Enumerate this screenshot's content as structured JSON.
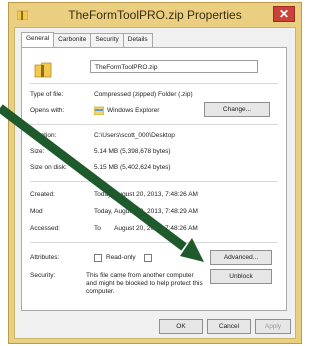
{
  "window": {
    "title": "TheFormToolPRO.zip Properties",
    "close_glyph": "✕"
  },
  "tabs": [
    {
      "label": "General",
      "active": true
    },
    {
      "label": "Carbonite"
    },
    {
      "label": "Security"
    },
    {
      "label": "Details"
    }
  ],
  "general": {
    "file_name": "TheFormToolPRO.zip",
    "type_label": "Type of file:",
    "type_value": "Compressed (zipped) Folder (.zip)",
    "opens_label": "Opens with:",
    "opens_value": "Windows Explorer",
    "change_label": "Change...",
    "location_label": "Location:",
    "location_value": "C:\\Users\\scott_000\\Desktop",
    "size_label": "Size:",
    "size_value": "5.14 MB (5,398,678 bytes)",
    "size_on_disk_label": "Size on disk:",
    "size_on_disk_value": "5.15 MB (5,402,624 bytes)",
    "created_label": "Created:",
    "created_value": "Today, August 20, 2013, 7:48:26 AM",
    "modified_label": "Mod",
    "modified_value": "Today, August 20, 2013, 7:48:29 AM",
    "accessed_label": "Accessed:",
    "accessed_value": "August 20, 2013, 7:48:26 AM",
    "accessed_prefix": "To",
    "attributes_label": "Attributes:",
    "readonly_label": "Read-only",
    "hidden_label": "",
    "advanced_label": "Advanced...",
    "security_label": "Security:",
    "security_text": "This file came from another computer and might be blocked to help protect this computer.",
    "unblock_label": "Unblock"
  },
  "footer": {
    "ok_label": "OK",
    "cancel_label": "Cancel",
    "apply_label": "Apply"
  },
  "colors": {
    "frame": "#e9cf7f",
    "arrow": "#1f5a2c",
    "close": "#c8423a"
  }
}
